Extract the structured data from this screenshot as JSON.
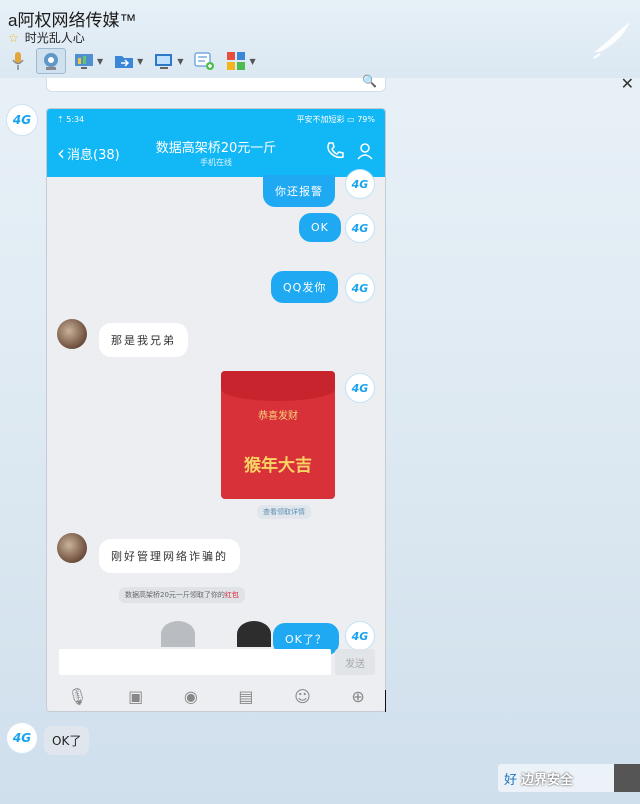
{
  "window": {
    "title": "a阿权网络传媒™",
    "subtitle": "时光乱人心"
  },
  "toolbar": {
    "items": [
      {
        "icon": "microphone-icon"
      },
      {
        "icon": "webcam-icon"
      },
      {
        "icon": "screen-share-icon"
      },
      {
        "icon": "file-transfer-icon"
      },
      {
        "icon": "remote-desktop-icon"
      },
      {
        "icon": "add-app-icon"
      },
      {
        "icon": "apps-grid-icon"
      }
    ]
  },
  "sender_avatar_label": "4G",
  "phone": {
    "status_left": "⇡ 5:34",
    "status_right": "平安不加短彩 ▭ 79%",
    "nav_back": "消息(38)",
    "nav_title": "数据高架桥20元一斤",
    "nav_subtitle": "手机在线",
    "messages": [
      {
        "side": "right",
        "text": "你还报警"
      },
      {
        "side": "right",
        "text": "OK"
      },
      {
        "side": "right",
        "text": "QQ发你"
      },
      {
        "side": "left",
        "text": "那是我兄弟"
      },
      {
        "side": "left",
        "text": "刚好管理网络诈骗的"
      },
      {
        "side": "right",
        "text": "OK了？"
      }
    ],
    "redpacket": {
      "wish": "恭喜发财",
      "greeting": "猴年大吉",
      "note": "查看领取详情"
    },
    "system_note": {
      "prefix": "数据高架桥20元一斤领取了你的",
      "highlight": "红包"
    },
    "send_label": "发送"
  },
  "bottom": {
    "ok_message": "OK了",
    "watermark_prefix": "好",
    "watermark_text": "边界安全"
  },
  "colors": {
    "qq_blue": "#12b7f5",
    "bubble_blue": "#1fa9f3",
    "red_packet": "#d9313a",
    "gold": "#f7d463"
  }
}
